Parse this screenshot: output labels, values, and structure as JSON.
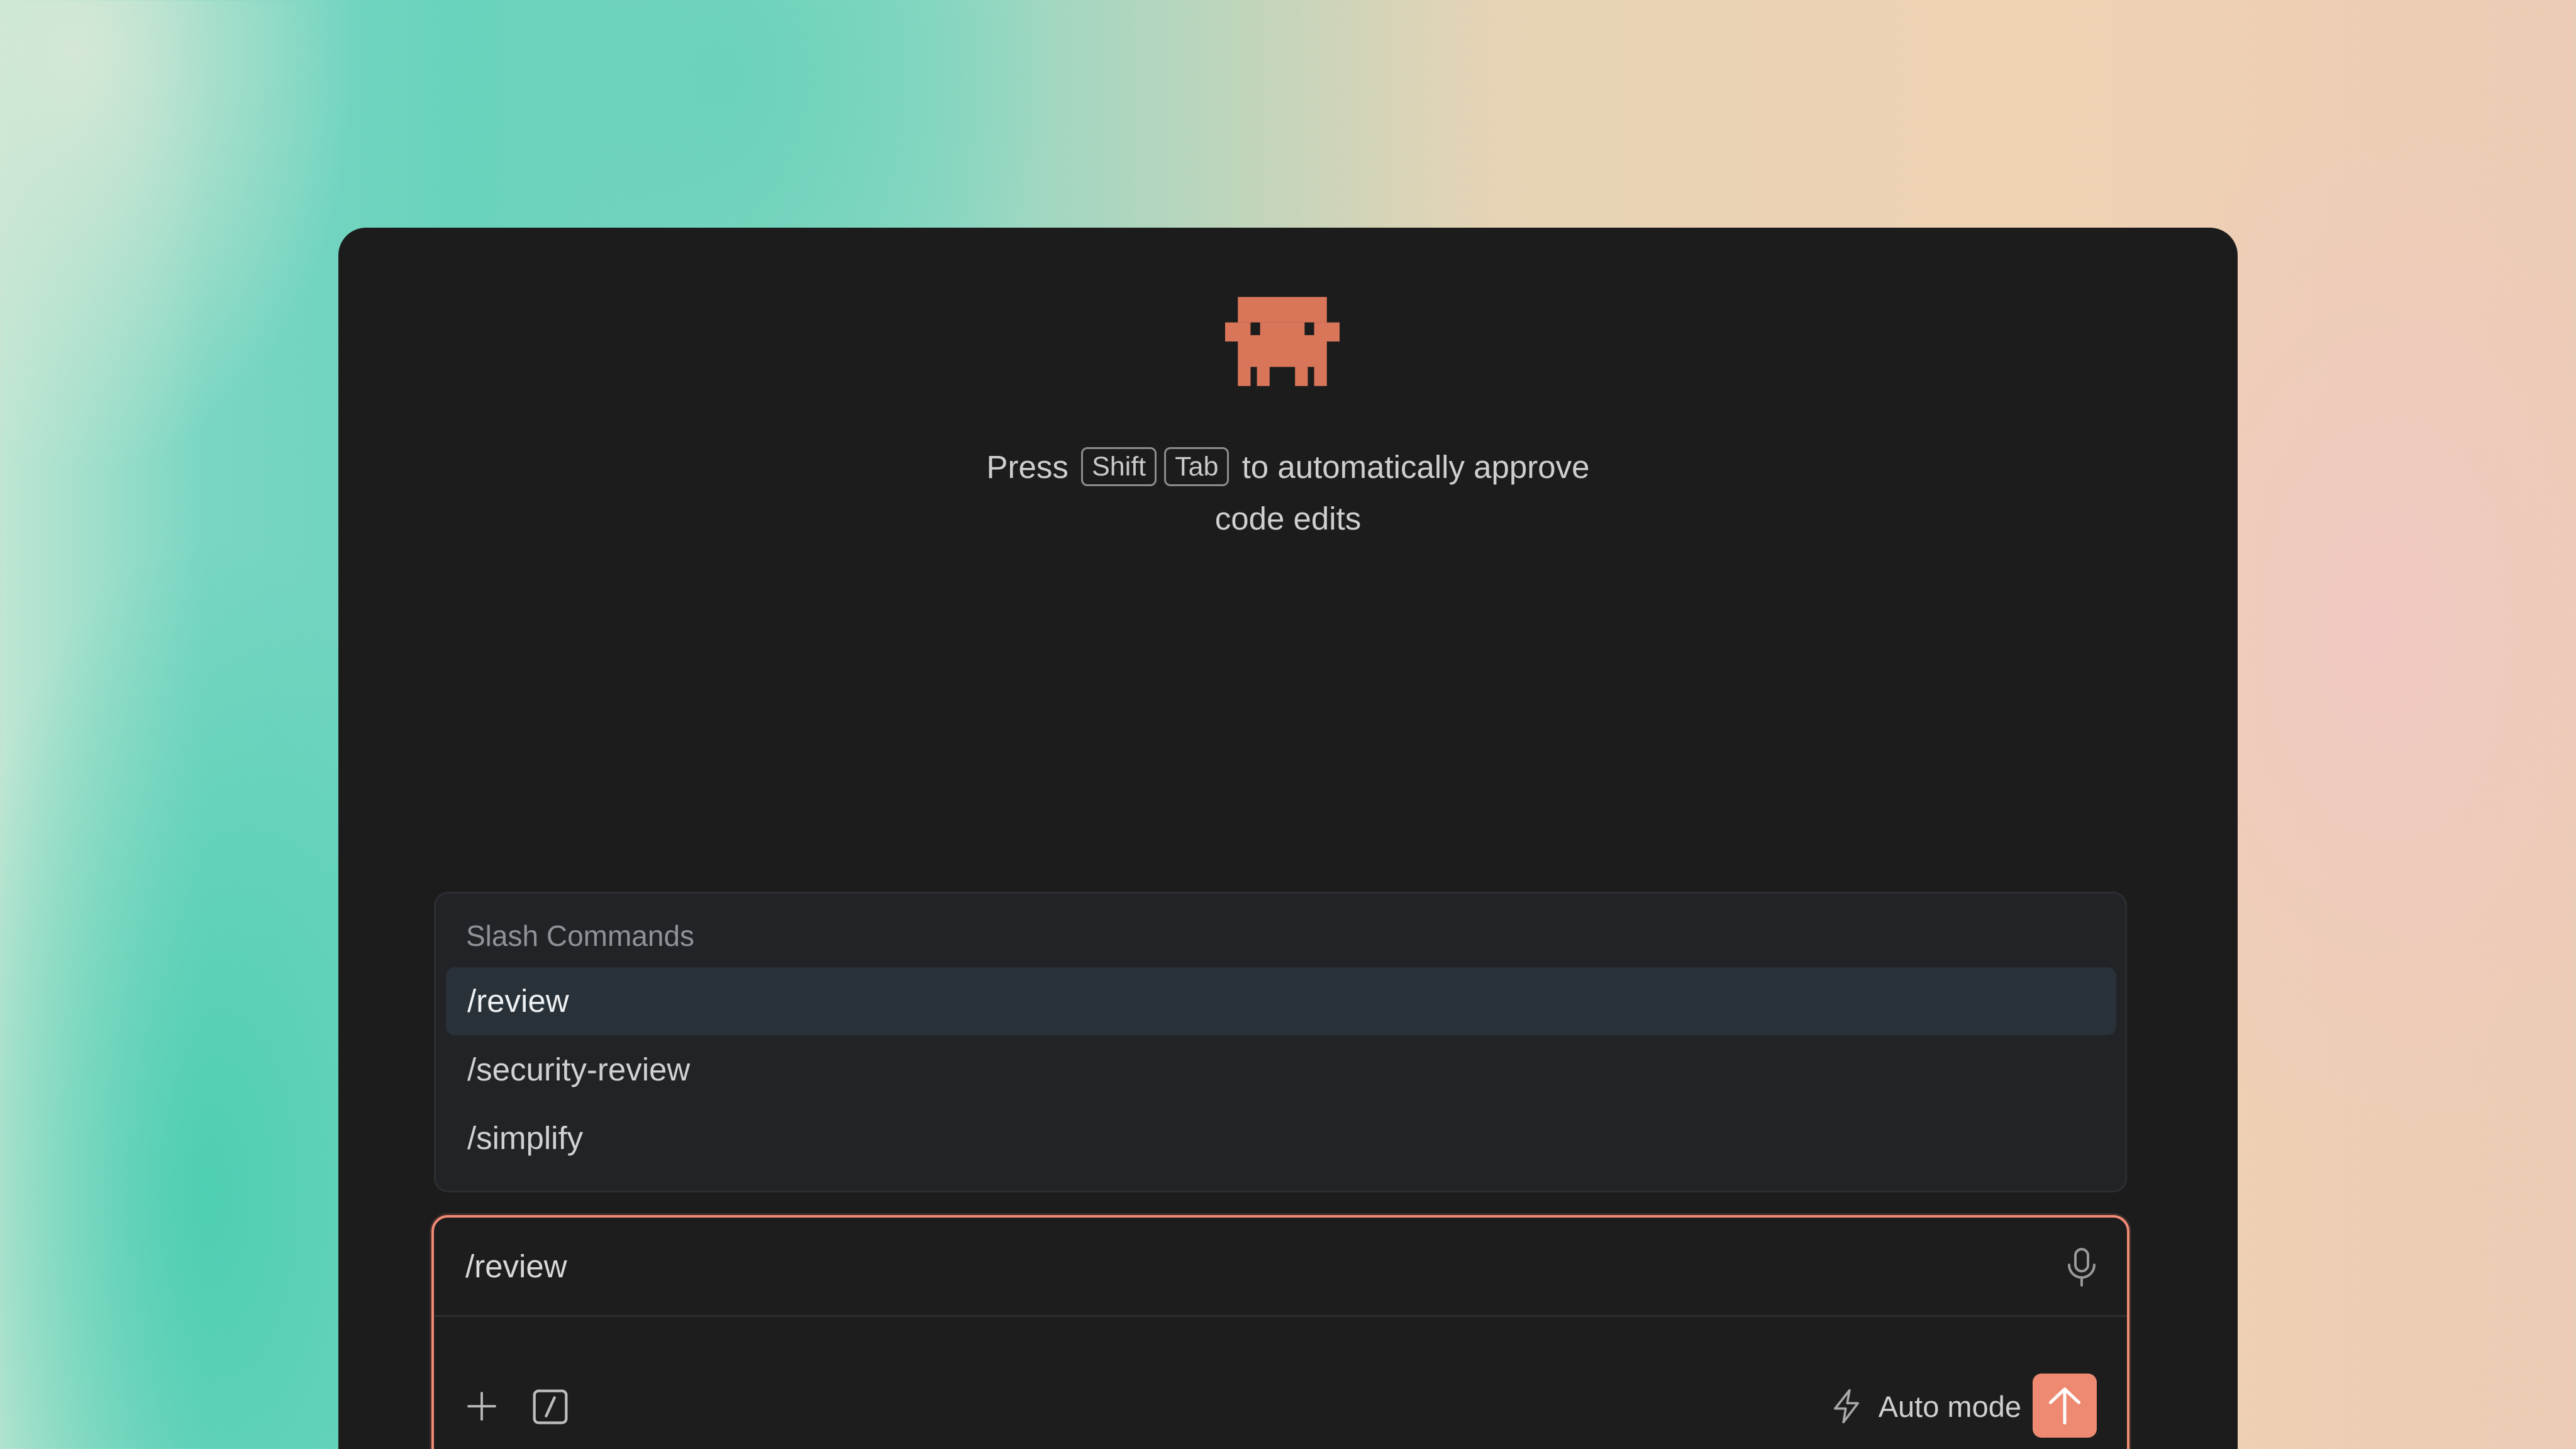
{
  "hint": {
    "before": "Press",
    "key1": "Shift",
    "key2": "Tab",
    "line1_after": "to automatically approve",
    "line2": "code edits"
  },
  "slash_commands": {
    "heading": "Slash Commands",
    "items": [
      {
        "label": "/review",
        "selected": true
      },
      {
        "label": "/security-review",
        "selected": false
      },
      {
        "label": "/simplify",
        "selected": false
      }
    ]
  },
  "composer": {
    "value": "/review",
    "mode_label": "Auto mode"
  },
  "icons": {
    "mascot": "pixel-creature-icon",
    "mic": "microphone-icon",
    "plus": "plus-icon",
    "slash": "slash-command-icon",
    "mode": "lightning-bolt-icon",
    "send": "arrow-up-icon"
  },
  "colors": {
    "accent": "#ee8a71",
    "window_bg": "#1c1c1c",
    "selected_row": "#293238",
    "mascot": "#d9765a"
  }
}
